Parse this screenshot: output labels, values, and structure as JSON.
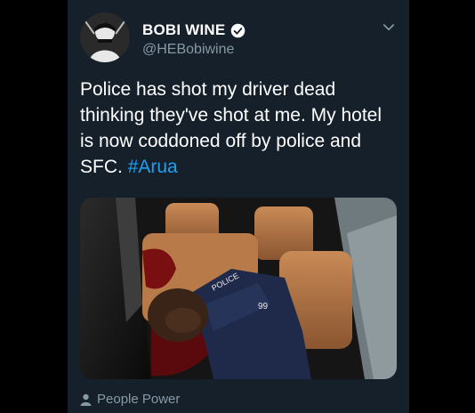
{
  "tweet": {
    "author": {
      "display_name": "BOBI WINE",
      "handle": "@HEBobiwine",
      "verified": true,
      "avatar_icon": "profile-photo"
    },
    "text_plain": "Police has shot my driver dead thinking they've shot at me. My hotel is now coddoned off by police and SFC.",
    "hashtag": "#Arua",
    "menu_icon": "chevron-down-icon",
    "media": {
      "type": "photo",
      "printed_text": "POLICE",
      "printed_number": "99"
    },
    "footer": {
      "icon": "person-icon",
      "label": "People Power"
    }
  },
  "colors": {
    "background": "#15202b",
    "text": "#ffffff",
    "secondary_text": "#8899a6",
    "accent": "#1da1f2"
  }
}
